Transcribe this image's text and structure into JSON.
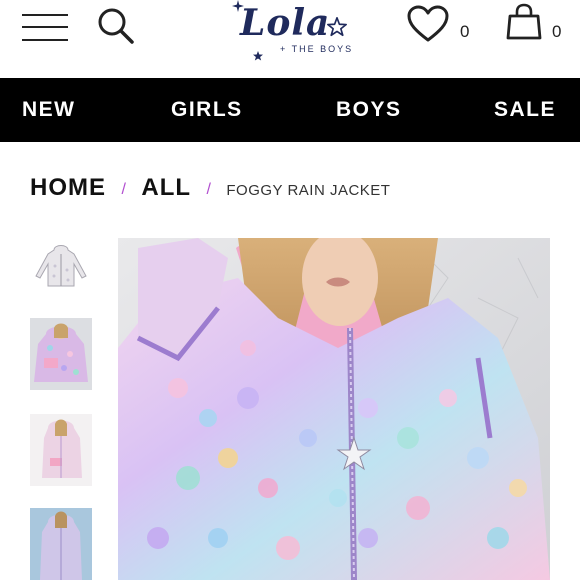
{
  "header": {
    "logo_text": "Lola",
    "logo_tagline": "+ THE BOYS",
    "wishlist_count": "0",
    "cart_count": "0"
  },
  "nav": {
    "items": [
      {
        "label": "NEW"
      },
      {
        "label": "GIRLS"
      },
      {
        "label": "BOYS"
      },
      {
        "label": "SALE"
      }
    ]
  },
  "breadcrumb": {
    "items": [
      {
        "label": "HOME"
      },
      {
        "label": "ALL"
      }
    ],
    "separator": "/",
    "current": "FOGGY RAIN JACKET"
  },
  "colors": {
    "nav_bg": "#000000",
    "nav_text": "#ffffff",
    "separator": "#b24fd0",
    "logo": "#1f2a5c"
  },
  "icons": [
    "menu-icon",
    "search-icon",
    "heart-icon",
    "shopping-bag-icon",
    "star-icon"
  ]
}
